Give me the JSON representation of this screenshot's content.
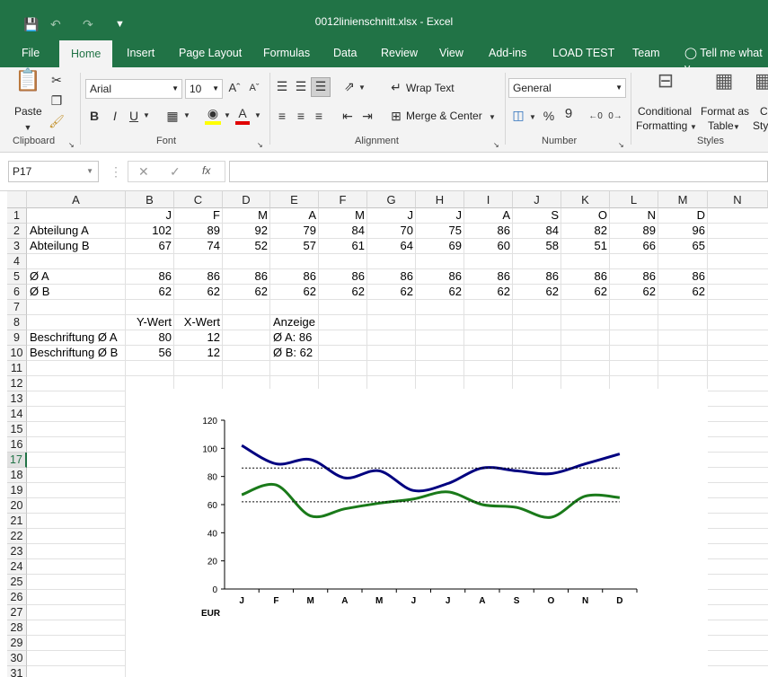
{
  "window": {
    "title": "0012linienschnitt.xlsx  -  Excel"
  },
  "tabs": [
    "File",
    "Home",
    "Insert",
    "Page Layout",
    "Formulas",
    "Data",
    "Review",
    "View",
    "Add-ins",
    "LOAD TEST",
    "Team"
  ],
  "tell_me": "Tell me what y",
  "ribbon": {
    "clipboard": {
      "paste": "Paste",
      "label": "Clipboard"
    },
    "font": {
      "name": "Arial",
      "size": "10",
      "label": "Font",
      "bold": "B",
      "italic": "I",
      "underline": "U"
    },
    "alignment": {
      "wrap": "Wrap Text",
      "merge": "Merge & Center",
      "label": "Alignment"
    },
    "number": {
      "format": "General",
      "percent": "%",
      "comma": "9",
      "label": "Number"
    },
    "styles": {
      "conditional": "Conditional",
      "formatting": "Formatting",
      "format_as": "Format as",
      "table": "Table",
      "cell": "Ce",
      "cell2": "Styl",
      "label": "Styles"
    }
  },
  "formula_bar": {
    "name_box": "P17",
    "fx": "fx",
    "formula": ""
  },
  "columns": [
    "A",
    "B",
    "C",
    "D",
    "E",
    "F",
    "G",
    "H",
    "I",
    "J",
    "K",
    "L",
    "M",
    "N"
  ],
  "rows": [
    "1",
    "2",
    "3",
    "4",
    "5",
    "6",
    "7",
    "8",
    "9",
    "10",
    "11",
    "12",
    "13",
    "14",
    "15",
    "16",
    "17",
    "18",
    "19",
    "20",
    "21",
    "22",
    "23",
    "24",
    "25",
    "26",
    "27",
    "28",
    "29",
    "30",
    "31"
  ],
  "sheet": {
    "months": [
      "J",
      "F",
      "M",
      "A",
      "M",
      "J",
      "J",
      "A",
      "S",
      "O",
      "N",
      "D"
    ],
    "row2": {
      "label": "Abteilung A",
      "values": [
        "102",
        "89",
        "92",
        "79",
        "84",
        "70",
        "75",
        "86",
        "84",
        "82",
        "89",
        "96"
      ]
    },
    "row3": {
      "label": "Abteilung B",
      "values": [
        "67",
        "74",
        "52",
        "57",
        "61",
        "64",
        "69",
        "60",
        "58",
        "51",
        "66",
        "65"
      ]
    },
    "row5": {
      "label": "Ø A",
      "values": [
        "86",
        "86",
        "86",
        "86",
        "86",
        "86",
        "86",
        "86",
        "86",
        "86",
        "86",
        "86"
      ]
    },
    "row6": {
      "label": "Ø B",
      "values": [
        "62",
        "62",
        "62",
        "62",
        "62",
        "62",
        "62",
        "62",
        "62",
        "62",
        "62",
        "62"
      ]
    },
    "row8": {
      "ywert": "Y-Wert",
      "xwert": "X-Wert",
      "anzeige": "Anzeige"
    },
    "row9": {
      "label": "Beschriftung Ø A",
      "y": "80",
      "x": "12",
      "display": "Ø A: 86"
    },
    "row10": {
      "label": "Beschriftung Ø B",
      "y": "56",
      "x": "12",
      "display": "Ø B: 62"
    }
  },
  "chart_data": {
    "type": "line",
    "categories": [
      "J",
      "F",
      "M",
      "A",
      "M",
      "J",
      "J",
      "A",
      "S",
      "O",
      "N",
      "D"
    ],
    "series": [
      {
        "values": [
          102,
          89,
          92,
          79,
          84,
          70,
          75,
          86,
          84,
          82,
          89,
          96
        ],
        "color": "#000080",
        "smooth": true
      },
      {
        "values": [
          67,
          74,
          52,
          57,
          61,
          64,
          69,
          60,
          58,
          51,
          66,
          65
        ],
        "color": "#1a7a1a",
        "smooth": true
      },
      {
        "values": [
          86,
          86,
          86,
          86,
          86,
          86,
          86,
          86,
          86,
          86,
          86,
          86
        ],
        "color": "#000000",
        "dashed": true
      },
      {
        "values": [
          62,
          62,
          62,
          62,
          62,
          62,
          62,
          62,
          62,
          62,
          62,
          62
        ],
        "color": "#000000",
        "dashed": true
      }
    ],
    "ylim": [
      0,
      120
    ],
    "yticks": [
      "0",
      "20",
      "40",
      "60",
      "80",
      "100",
      "120"
    ],
    "unit_label": "EUR",
    "grid": false
  }
}
